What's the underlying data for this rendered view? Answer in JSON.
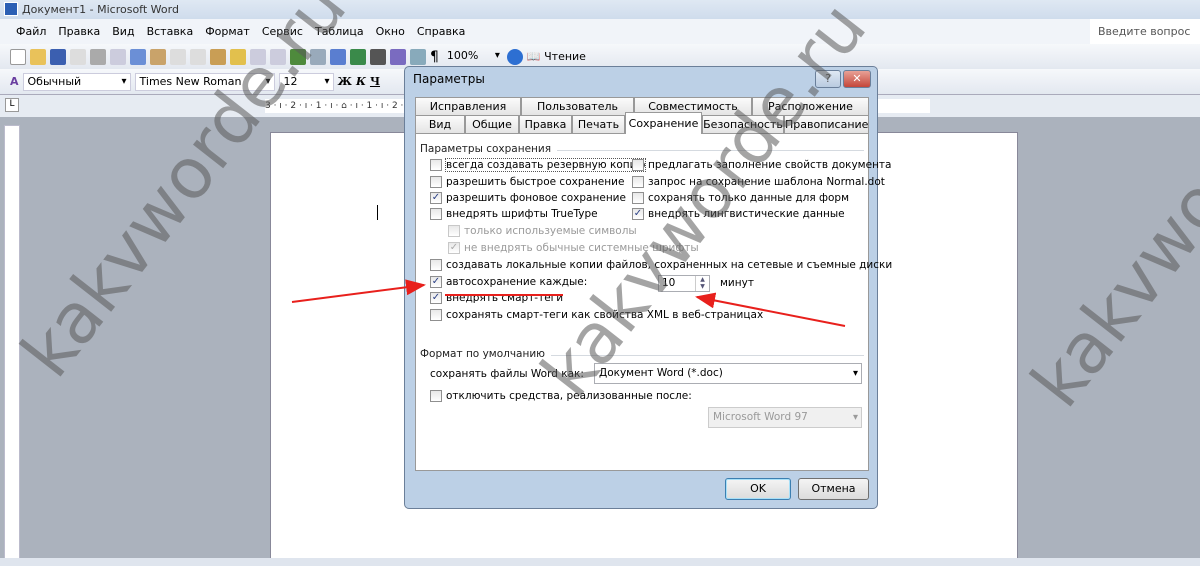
{
  "window": {
    "title": "Документ1 - Microsoft Word"
  },
  "menu": [
    "Файл",
    "Правка",
    "Вид",
    "Вставка",
    "Формат",
    "Сервис",
    "Таблица",
    "Окно",
    "Справка"
  ],
  "ask_placeholder": "Введите вопрос",
  "toolbar": {
    "zoom": "100%",
    "reading": "Чтение"
  },
  "format_toolbar": {
    "style": "Обычный",
    "font": "Times New Roman",
    "size": "12",
    "bold": "Ж",
    "italic": "К",
    "underline": "Ч"
  },
  "ruler": "3 · ı · 2 · ı · 1 · ı · ⌂ · ı · 1 · ı · 2 · ı · 3 · ı · 4 · ı · 5 · ı · 6 · ı · 7 · ı · 8 · ı · 9 · ı · 10 · ı · 11 · ı · 12 · ı · 13 · ı · 14 · ı · 15 · ı · 16 · △ · 17 · ı · ı",
  "dialog": {
    "title": "Параметры",
    "help": "?",
    "close": "✕",
    "tabs_row1": [
      "Исправления",
      "Пользователь",
      "Совместимость",
      "Расположение"
    ],
    "tabs_row2": [
      "Вид",
      "Общие",
      "Правка",
      "Печать",
      "Сохранение",
      "Безопасность",
      "Правописание"
    ],
    "active_tab": "Сохранение",
    "group1": "Параметры сохранения",
    "options_left": [
      {
        "label": "всегда создавать резервную копию",
        "checked": false
      },
      {
        "label": "разрешить быстрое сохранение",
        "checked": false
      },
      {
        "label": "разрешить фоновое сохранение",
        "checked": true
      },
      {
        "label": "внедрять шрифты TrueType",
        "checked": false
      }
    ],
    "options_right": [
      {
        "label": "предлагать заполнение свойств документа",
        "checked": false
      },
      {
        "label": "запрос на сохранение шаблона Normal.dot",
        "checked": false
      },
      {
        "label": "сохранять только данные для форм",
        "checked": false
      },
      {
        "label": "внедрять лингвистические данные",
        "checked": true
      }
    ],
    "sub_options": [
      {
        "label": "только используемые символы",
        "checked": false,
        "disabled": true
      },
      {
        "label": "не внедрять обычные системные шрифты",
        "checked": true,
        "disabled": true
      }
    ],
    "local_copies": {
      "label": "создавать локальные копии файлов, сохраненных на сетевые и съемные диски",
      "checked": false
    },
    "autosave": {
      "label": "автосохранение каждые:",
      "checked": true,
      "value": "10",
      "unit": "минут"
    },
    "smart_tags": {
      "label": "внедрять смарт-теги",
      "checked": true
    },
    "smart_xml": {
      "label": "сохранять смарт-теги как свойства XML в веб-страницах",
      "checked": false
    },
    "group2": "Формат по умолчанию",
    "save_as_label": "сохранять файлы Word как:",
    "save_as_value": "Документ Word (*.doc)",
    "disable_features": {
      "label": "отключить средства, реализованные после:",
      "checked": false
    },
    "disable_value": "Microsoft Word 97",
    "ok": "OK",
    "cancel": "Отмена"
  },
  "watermark": "kakvworde.ru",
  "colors": {
    "annotation": "#e8201c",
    "accent": "#2a5ea8"
  }
}
